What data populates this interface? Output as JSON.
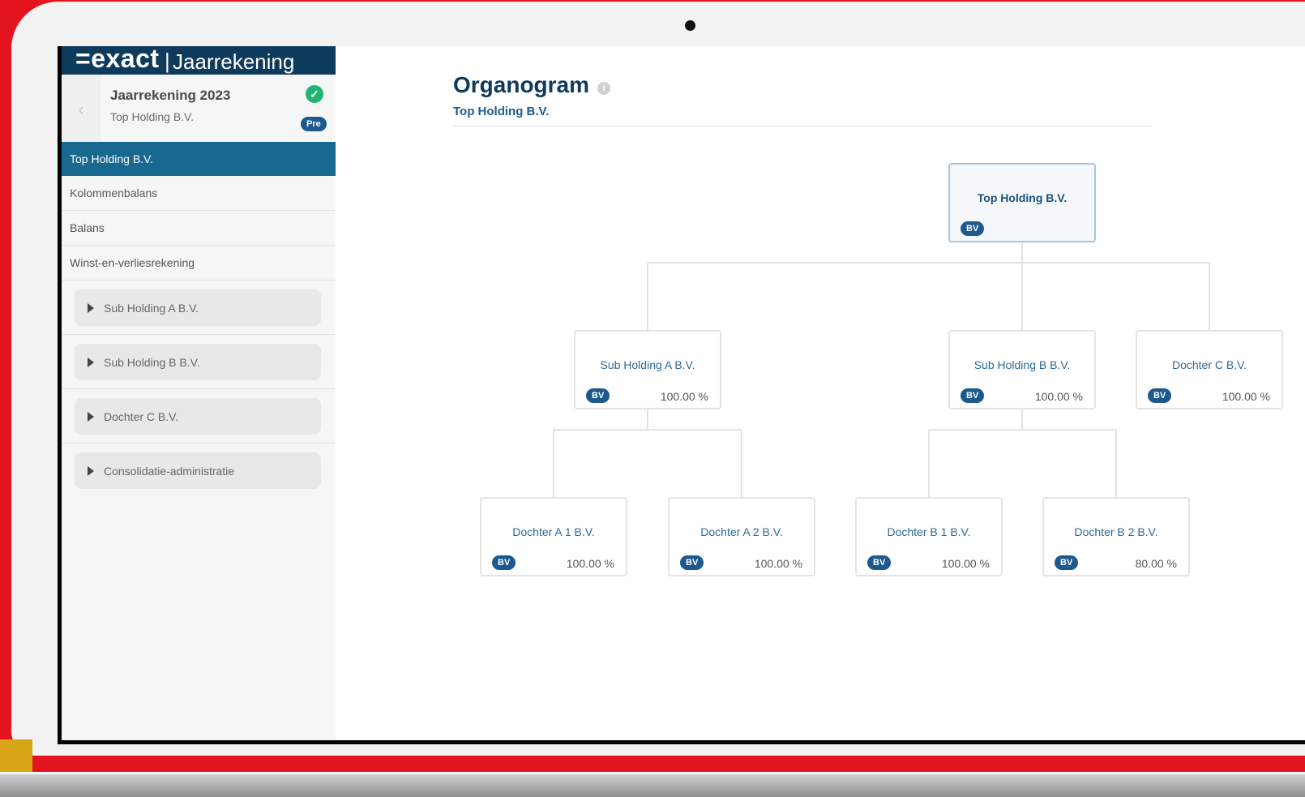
{
  "app": {
    "logo_main": "=exact",
    "logo_separator": "|",
    "logo_sub": "Jaarrekening"
  },
  "context": {
    "title": "Jaarrekening 2023",
    "company": "Top Holding B.V.",
    "status_badge": "Pre",
    "back_glyph": "‹",
    "check_glyph": "✓"
  },
  "sidebar": {
    "active": "Top Holding B.V.",
    "items": [
      "Kolommenbalans",
      "Balans",
      "Winst-en-verliesrekening"
    ],
    "groups": [
      "Sub Holding A B.V.",
      "Sub Holding B B.V.",
      "Dochter C B.V.",
      "Consolidatie-administratie"
    ]
  },
  "main": {
    "title": "Organogram",
    "info_glyph": "i",
    "subtitle": "Top Holding B.V."
  },
  "org": {
    "root": {
      "name": "Top Holding B.V.",
      "type": "BV"
    },
    "level1": [
      {
        "name": "Sub Holding A B.V.",
        "type": "BV",
        "pct": "100.00 %"
      },
      {
        "name": "Sub Holding B B.V.",
        "type": "BV",
        "pct": "100.00 %"
      },
      {
        "name": "Dochter C B.V.",
        "type": "BV",
        "pct": "100.00 %"
      }
    ],
    "level2": [
      {
        "name": "Dochter A 1 B.V.",
        "type": "BV",
        "pct": "100.00 %"
      },
      {
        "name": "Dochter A 2 B.V.",
        "type": "BV",
        "pct": "100.00 %"
      },
      {
        "name": "Dochter B 1 B.V.",
        "type": "BV",
        "pct": "100.00 %"
      },
      {
        "name": "Dochter B 2 B.V.",
        "type": "BV",
        "pct": "80.00 %"
      }
    ]
  }
}
